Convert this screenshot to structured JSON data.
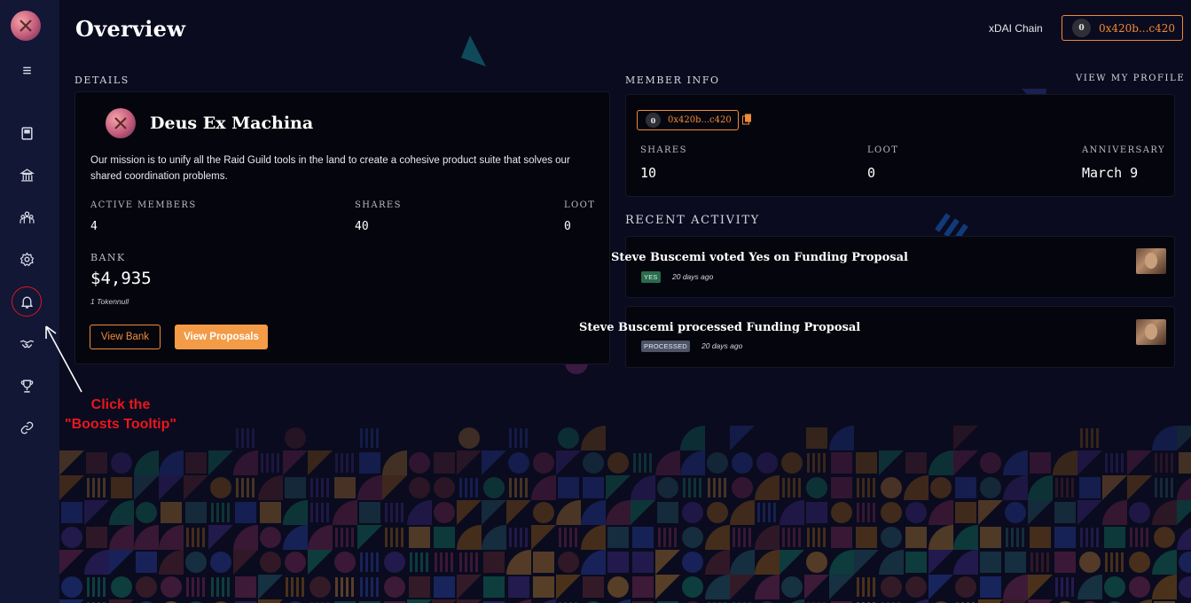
{
  "header": {
    "title": "Overview",
    "chain": "xDAI Chain",
    "address": "0x420b...c420",
    "address_avatar": "0"
  },
  "sidebar": {
    "items": [
      {
        "icon": "menu-icon"
      },
      {
        "icon": "proposals-icon"
      },
      {
        "icon": "bank-icon"
      },
      {
        "icon": "members-icon"
      },
      {
        "icon": "settings-icon"
      },
      {
        "icon": "boosts-bell-icon"
      },
      {
        "icon": "handshake-icon"
      },
      {
        "icon": "trophy-icon"
      },
      {
        "icon": "link-icon"
      }
    ]
  },
  "details": {
    "section_label": "DETAILS",
    "dao_name": "Deus Ex Machina",
    "description": "Our mission is to unify all the Raid Guild tools in the land to create a cohesive product suite that solves our shared coordination problems.",
    "active_members_label": "ACTIVE MEMBERS",
    "active_members": "4",
    "shares_label": "SHARES",
    "shares": "40",
    "loot_label": "LOOT",
    "loot": "0",
    "bank_label": "BANK",
    "bank_value": "$4,935",
    "token_note": "1 Tokennull",
    "view_bank": "View Bank",
    "view_proposals": "View Proposals"
  },
  "member_info": {
    "section_label": "MEMBER INFO",
    "view_profile": "VIEW MY PROFILE",
    "address": "0x420b...c420",
    "address_avatar": "0",
    "shares_label": "SHARES",
    "shares": "10",
    "loot_label": "LOOT",
    "loot": "0",
    "anniversary_label": "ANNIVERSARY",
    "anniversary": "March 9"
  },
  "recent_activity": {
    "section_label": "RECENT ACTIVITY",
    "items": [
      {
        "title": "Steve Buscemi voted Yes on Funding Proposal",
        "badge": "YES",
        "time": "20 days ago"
      },
      {
        "title": "Steve Buscemi  processed Funding Proposal",
        "badge": "PROCESSED",
        "time": "20 days ago"
      }
    ]
  },
  "annotation": {
    "line1": "Click the",
    "line2": "\"Boosts Tooltip\""
  },
  "colors": {
    "accent": "#f08b37",
    "background": "#0a0b1e",
    "sidebar": "#111734",
    "annotation": "#e8171f"
  }
}
